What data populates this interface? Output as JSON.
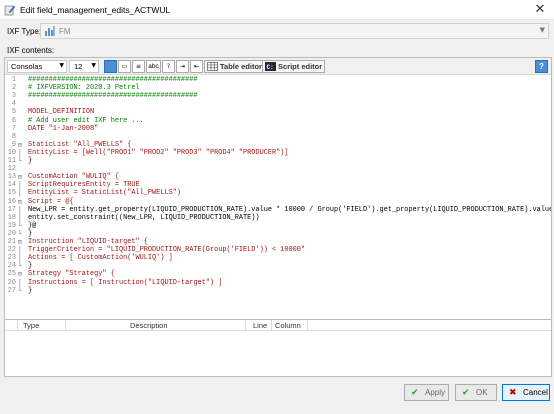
{
  "window": {
    "title": "Edit field_management_edits_ACTWUL"
  },
  "ixf_type": {
    "label": "IXF Type:",
    "value": "FM"
  },
  "contents_label": "IXF contents:",
  "toolbar": {
    "font": "Consolas",
    "size": "12",
    "abc": "abc",
    "table_editor": "Table editor",
    "script_editor": "Script editor",
    "help": "?"
  },
  "code_lines": [
    {
      "n": "1",
      "fold": "",
      "text": "#########################################",
      "cls": "c-comment"
    },
    {
      "n": "2",
      "fold": "",
      "text": "# IXFVERSION: 2020.3 Petrel",
      "cls": "c-comment"
    },
    {
      "n": "3",
      "fold": "",
      "text": "#########################################",
      "cls": "c-comment"
    },
    {
      "n": "4",
      "fold": "",
      "text": "",
      "cls": "c-plain"
    },
    {
      "n": "5",
      "fold": "",
      "text": "MODEL_DEFINITION",
      "cls": "c-red"
    },
    {
      "n": "6",
      "fold": "",
      "text": "# Add user edit IXF here ...",
      "cls": "c-comment"
    },
    {
      "n": "7",
      "fold": "",
      "text": "DATE \"1-Jan-2008\"",
      "cls": "c-red"
    },
    {
      "n": "8",
      "fold": "",
      "text": "",
      "cls": "c-plain"
    },
    {
      "n": "9",
      "fold": "⊟",
      "text": "StaticList \"All_PWELLS\" {",
      "cls": "c-red"
    },
    {
      "n": "10",
      "fold": "│",
      "text": "EntityList = [Well(\"PROD1\" \"PROD2\" \"PROD3\" \"PROD4\" \"PRODUCER\")]",
      "cls": "c-red"
    },
    {
      "n": "11",
      "fold": "└",
      "text": "}",
      "cls": "c-plain"
    },
    {
      "n": "12",
      "fold": "",
      "text": "",
      "cls": "c-plain"
    },
    {
      "n": "13",
      "fold": "⊟",
      "text": "CustomAction \"WULIQ\" {",
      "cls": "c-red"
    },
    {
      "n": "14",
      "fold": "│",
      "text": "ScriptRequiresEntity = TRUE",
      "cls": "c-red"
    },
    {
      "n": "15",
      "fold": "│",
      "text": "EntityList = StaticList(\"All_PWELLS\")",
      "cls": "c-red"
    },
    {
      "n": "16",
      "fold": "⊟",
      "text": "Script = @{",
      "cls": "c-red"
    },
    {
      "n": "17",
      "fold": "│",
      "text": "New_LPR = entity.get_property(LIQUID_PRODUCTION_RATE).value * 10000 / Group('FIELD').get_property(LIQUID_PRODUCTION_RATE).value",
      "cls": "c-plain"
    },
    {
      "n": "18",
      "fold": "│",
      "text": "entity.set_constraint((New_LPR, LIQUID_PRODUCTION_RATE))",
      "cls": "c-plain"
    },
    {
      "n": "19",
      "fold": "└",
      "text": "}@",
      "cls": "c-plain"
    },
    {
      "n": "20",
      "fold": "└",
      "text": "}",
      "cls": "c-plain"
    },
    {
      "n": "21",
      "fold": "⊟",
      "text": "Instruction \"LIQUID-target\" {",
      "cls": "c-red"
    },
    {
      "n": "22",
      "fold": "│",
      "text": "TriggerCriterion = \"LIQUID_PRODUCTION_RATE(Group('FIELD')) < 10000\"",
      "cls": "c-red"
    },
    {
      "n": "23",
      "fold": "│",
      "text": "Actions = [ CustomAction('WULIQ') ]",
      "cls": "c-red"
    },
    {
      "n": "24",
      "fold": "└",
      "text": "}",
      "cls": "c-plain"
    },
    {
      "n": "25",
      "fold": "⊟",
      "text": "Strategy \"Strategy\" {",
      "cls": "c-red"
    },
    {
      "n": "26",
      "fold": "│",
      "text": "Instructions = [ Instruction(\"LIQUID-target\") ]",
      "cls": "c-red"
    },
    {
      "n": "27",
      "fold": "└",
      "text": "}",
      "cls": "c-plain"
    }
  ],
  "errors_table": {
    "columns": [
      "Type",
      "Description",
      "Line",
      "Column"
    ]
  },
  "buttons": {
    "apply": "Apply",
    "ok": "OK",
    "cancel": "Cancel"
  },
  "colors": {
    "help_blue": "#4a8fd8",
    "comment_green": "#008000",
    "keyword_red": "#a31515",
    "cancel_red": "#c00000",
    "ok_green": "#2a9d2a"
  },
  "icons": [
    "app-icon",
    "fm-icon",
    "close-icon",
    "table-editor-icon",
    "script-editor-icon",
    "help-icon",
    "apply-check-icon",
    "ok-check-icon",
    "cancel-x-icon"
  ]
}
